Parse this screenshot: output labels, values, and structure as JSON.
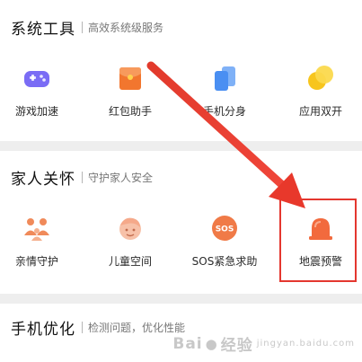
{
  "sections": [
    {
      "title": "系统工具",
      "subtitle": "高效系统级服务",
      "items": [
        {
          "label": "游戏加速",
          "icon": "gamepad-icon",
          "color": "#7a6cf5"
        },
        {
          "label": "红包助手",
          "icon": "red-envelope-icon",
          "color": "#f2762e"
        },
        {
          "label": "手机分身",
          "icon": "phone-clone-icon",
          "color": "#4a8ff2"
        },
        {
          "label": "应用双开",
          "icon": "dual-app-icon",
          "color": "#f7c51d"
        }
      ]
    },
    {
      "title": "家人关怀",
      "subtitle": "守护家人安全",
      "items": [
        {
          "label": "亲情守护",
          "icon": "family-guard-icon",
          "color": "#f08a5a"
        },
        {
          "label": "儿童空间",
          "icon": "kids-space-icon",
          "color": "#f5a98a"
        },
        {
          "label": "SOS紧急求助",
          "icon": "sos-icon",
          "color": "#f07a47"
        },
        {
          "label": "地震预警",
          "icon": "earthquake-alarm-icon",
          "color": "#f26a3d"
        }
      ]
    },
    {
      "title": "手机优化",
      "subtitle": "检测问题，优化性能"
    }
  ],
  "annotation": {
    "arrow_color": "#e4372f",
    "highlight_color": "#e4372f"
  },
  "watermark": {
    "left": "Bai",
    "mid": "经验",
    "sub": "jingyan.baidu.com"
  }
}
